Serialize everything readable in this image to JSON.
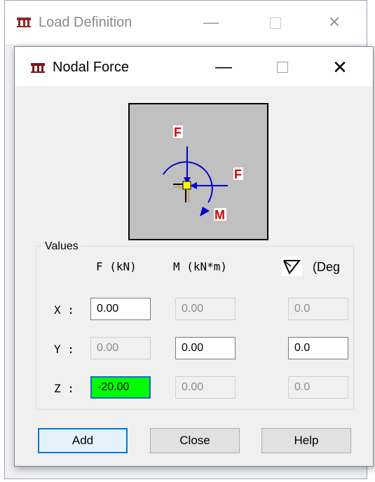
{
  "background_window": {
    "title": "Load Definition",
    "controls": {
      "minimize": "—",
      "close": "✕"
    }
  },
  "dialog": {
    "title": "Nodal Force",
    "controls": {
      "minimize": "—",
      "close": "✕"
    },
    "diagram": {
      "labels": {
        "force_vertical": "F",
        "force_horizontal": "F",
        "moment": "M"
      },
      "colors": {
        "force_arrows": "#0000cc",
        "labels": "#dd0000",
        "node": "#ffff00",
        "background": "#c0c0c0"
      }
    },
    "values": {
      "group_label": "Values",
      "headers": {
        "force": "F (kN)",
        "moment": "M (kN*m)",
        "angle": "(Deg"
      },
      "rows": [
        {
          "label": "X :",
          "force": "0.00",
          "moment": "0.00",
          "angle": "0.0"
        },
        {
          "label": "Y :",
          "force": "0.00",
          "moment": "0.00",
          "angle": "0.0"
        },
        {
          "label": "Z :",
          "force": "-20.00",
          "moment": "0.00",
          "angle": "0.0"
        }
      ]
    },
    "buttons": {
      "add": "Add",
      "close": "Close",
      "help": "Help"
    }
  }
}
